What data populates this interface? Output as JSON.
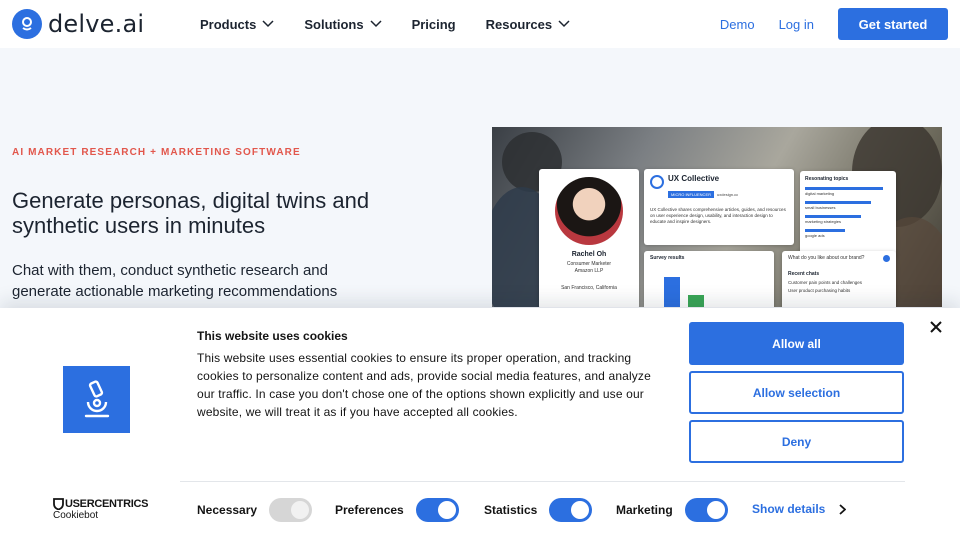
{
  "nav": {
    "brand": "delve.ai",
    "menu": [
      {
        "label": "Products",
        "dropdown": true
      },
      {
        "label": "Solutions",
        "dropdown": true
      },
      {
        "label": "Pricing",
        "dropdown": false
      },
      {
        "label": "Resources",
        "dropdown": true
      }
    ],
    "demo": "Demo",
    "login": "Log in",
    "cta": "Get started"
  },
  "hero": {
    "eyebrow": "AI MARKET RESEARCH + MARKETING SOFTWARE",
    "headline": "Generate personas, digital twins and synthetic users in minutes",
    "subline": "Chat with them, conduct synthetic research and generate actionable marketing recommendations",
    "image": {
      "persona_name": "Rachel Oh",
      "persona_role": "Consumer Marketer",
      "persona_company": "Amazon LLP",
      "persona_location": "San Francisco, California",
      "ux_title": "UX Collective",
      "ux_badge": "MICRO INFLUENCER",
      "ux_url": "uxdesign.cc",
      "ux_desc": "UX Collective shares comprehensive articles, guides, and resources on user experience design, usability, and interaction design to educate and inspire designers.",
      "topics_title": "Resonating topics",
      "topics": [
        "digital marketing",
        "small businesses",
        "marketing strategies",
        "google ads"
      ],
      "survey_title": "Survey results",
      "chat_question": "What do you like about our brand?",
      "recent_chats_title": "Recent chats",
      "recent_chats": [
        "Customer pain points and challenges",
        "User product purchasing habits"
      ]
    }
  },
  "cookie": {
    "title": "This website uses cookies",
    "text": "This website uses essential cookies to ensure its proper operation, and tracking cookies to personalize content and ads, provide social media features, and analyze our traffic. In case you don't chose one of the options shown explicitly and use our website, we will treat it as if you have accepted all cookies.",
    "allow_all": "Allow all",
    "allow_selection": "Allow selection",
    "deny": "Deny",
    "brand_name": "USERCENTRICS",
    "brand_sub": "Cookiebot",
    "toggles": [
      {
        "label": "Necessary",
        "on": true,
        "disabled": true
      },
      {
        "label": "Preferences",
        "on": true
      },
      {
        "label": "Statistics",
        "on": true
      },
      {
        "label": "Marketing",
        "on": true
      }
    ],
    "show_details": "Show details",
    "accent": "#2c6fe0"
  }
}
